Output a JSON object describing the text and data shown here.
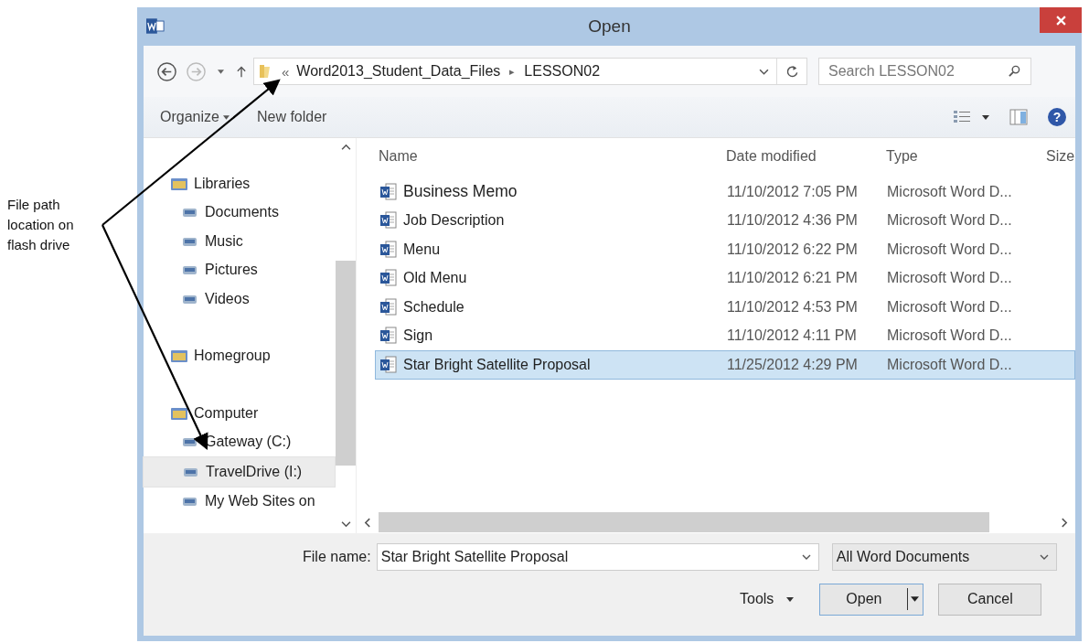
{
  "callout": {
    "text": "File path location on flash drive"
  },
  "window": {
    "title": "Open"
  },
  "address": {
    "separator_left": "«",
    "segments": [
      "Word2013_Student_Data_Files",
      "LESSON02"
    ],
    "separator": "▸"
  },
  "search": {
    "placeholder": "Search LESSON02"
  },
  "commands": {
    "organize": "Organize",
    "new_folder": "New folder",
    "help": "?"
  },
  "nav": [
    {
      "label": "Libraries",
      "selected": false,
      "children": [
        {
          "label": "Documents",
          "selected": false
        },
        {
          "label": "Music",
          "selected": false
        },
        {
          "label": "Pictures",
          "selected": false
        },
        {
          "label": "Videos",
          "selected": false
        }
      ]
    },
    {
      "label": "Homegroup",
      "selected": false
    },
    {
      "label": "Computer",
      "selected": false,
      "children": [
        {
          "label": "Gateway (C:)",
          "selected": false
        },
        {
          "label": "TravelDrive (I:)",
          "selected": true
        },
        {
          "label": "My Web Sites on",
          "selected": false
        }
      ]
    }
  ],
  "table": {
    "columns": [
      "Name",
      "Date modified",
      "Type",
      "Size"
    ],
    "rows": [
      {
        "name": "Business Memo",
        "date": "11/10/2012 7:05 PM",
        "type": "Microsoft Word D...",
        "selected": false
      },
      {
        "name": "Job Description",
        "date": "11/10/2012 4:36 PM",
        "type": "Microsoft Word D...",
        "selected": false
      },
      {
        "name": "Menu",
        "date": "11/10/2012 6:22 PM",
        "type": "Microsoft Word D...",
        "selected": false
      },
      {
        "name": "Old Menu",
        "date": "11/10/2012 6:21 PM",
        "type": "Microsoft Word D...",
        "selected": false
      },
      {
        "name": "Schedule",
        "date": "11/10/2012 4:53 PM",
        "type": "Microsoft Word D...",
        "selected": false
      },
      {
        "name": "Sign",
        "date": "11/10/2012 4:11 PM",
        "type": "Microsoft Word D...",
        "selected": false
      },
      {
        "name": "Star Bright Satellite Proposal",
        "date": "11/25/2012 4:29 PM",
        "type": "Microsoft Word D...",
        "selected": true
      }
    ]
  },
  "file_name": {
    "label": "File name:",
    "value": "Star Bright Satellite Proposal"
  },
  "file_type": {
    "value": "All Word Documents"
  },
  "buttons": {
    "tools": "Tools",
    "open": "Open",
    "cancel": "Cancel"
  }
}
